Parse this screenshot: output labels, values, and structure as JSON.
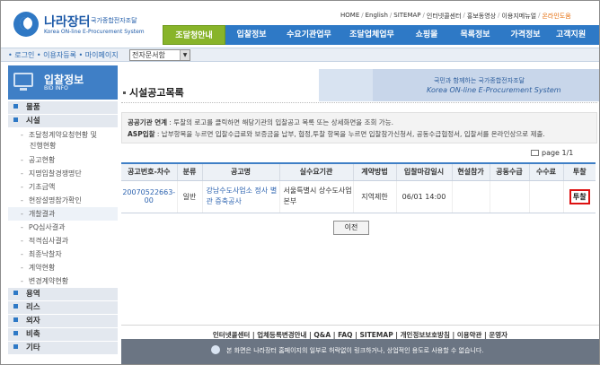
{
  "header": {
    "logo_ko": "나라장터",
    "logo_sub": "국가종합전자조달",
    "logo_en": "Korea ON-line E-Procurement System",
    "util_links": [
      "HOME",
      "English",
      "SITEMAP",
      "인터넷콜센터",
      "홍보동영상",
      "이용지메뉴얼",
      "온라인도움"
    ],
    "nav": [
      "조달청안내",
      "입찰정보",
      "수요기관업무",
      "조달업체업무",
      "쇼핑몰",
      "목록정보",
      "가격정보",
      "고객지원"
    ],
    "active_nav": "조달청안내"
  },
  "subbar": {
    "links": "• 로그인 • 이용자등록 • 마이페이지",
    "select_value": "전자문서함"
  },
  "sidebar": {
    "title": "입찰정보",
    "subtitle": "BID INFO",
    "groups": [
      {
        "label": "물품"
      },
      {
        "label": "시설"
      },
      {
        "label": "용역"
      },
      {
        "label": "리스"
      },
      {
        "label": "외자"
      },
      {
        "label": "비축"
      },
      {
        "label": "기타"
      }
    ],
    "facility_items": [
      "조달청계약요청현황 및",
      "진행현황",
      "공고현황",
      "지명입찰경쟁명단",
      "기초금액",
      "현장설명참가확인",
      "개찰결과",
      "PQ심사결과",
      "적격심사결과",
      "최종낙찰자",
      "계약현황",
      "변경계약현황"
    ]
  },
  "banner": {
    "ko": "국민과 함께하는 국가종합전자조달",
    "en": "Korea ON-line E-Procurement System"
  },
  "page_title": "시설공고목록",
  "notice": {
    "line1_label": "공공기관 연계",
    "line1_text": " : 투찰의 로고를 클릭하면 해당기관의 입찰공고 목록 또는 상세화면을 조회 가능.",
    "line2_label": "ASP입찰",
    "line2_text": " : 납부항목을 누르면 입찰수급료와 보증금을 납부, 협정,투찰 항목을 누르면 입찰참가신청서, 공동수급협정서, 입찰서를 온라인상으로 제출."
  },
  "pager": "page 1/1",
  "table": {
    "headers": [
      "공고번호-차수",
      "분류",
      "공고명",
      "실수요기관",
      "계약방법",
      "입찰마감일시",
      "현설참가",
      "공동수급",
      "수수료",
      "투찰"
    ],
    "rows": [
      {
        "no": "20070522663-00",
        "cat": "일반",
        "name": "강남수도사업소 정사 별관 증축공사",
        "agency": "서울특별시 상수도사업본부",
        "method": "지역제한",
        "deadline": "06/01 14:00",
        "site": "",
        "joint": "",
        "fee": "",
        "bid": "투찰"
      }
    ]
  },
  "prev_button": "이전",
  "footer": {
    "links": "인터넷콜센터 | 업체등록변경안내 | Q&A | FAQ | SITEMAP | 개인정보보호방침 | 이용약관 | 운영자",
    "notice": "본 화면은 나라장터 홈페이지의 일부로 허락없이 링크하거나, 상업적인 용도로 사용할 수 없습니다."
  }
}
